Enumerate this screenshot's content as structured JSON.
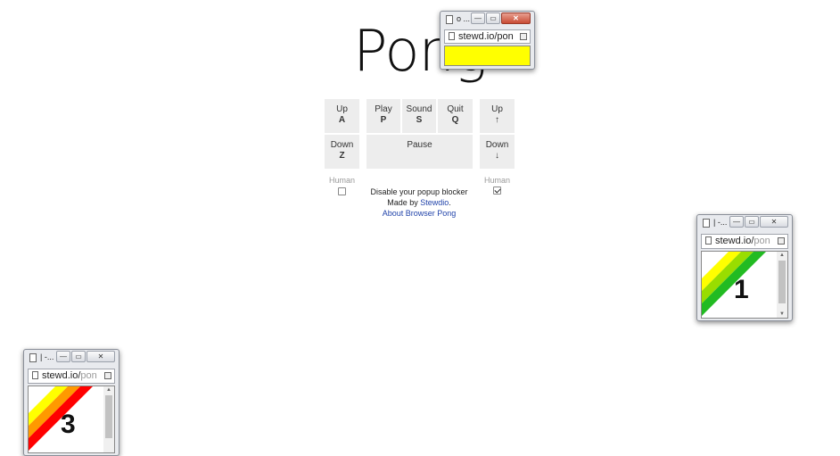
{
  "title": "Pong",
  "controls": {
    "left": {
      "up_label": "Up",
      "up_key": "A",
      "down_label": "Down",
      "down_key": "Z",
      "human_label": "Human",
      "human_checked": false
    },
    "middle": {
      "play_label": "Play",
      "play_key": "P",
      "sound_label": "Sound",
      "sound_key": "S",
      "quit_label": "Quit",
      "quit_key": "Q",
      "pause_label": "Pause"
    },
    "right": {
      "up_label": "Up",
      "up_key": "↑",
      "down_label": "Down",
      "down_key": "↓",
      "human_label": "Human",
      "human_checked": true
    }
  },
  "info": {
    "popup_notice": "Disable your popup blocker",
    "made_by_prefix": "Made by",
    "made_by_link": "Stewdio",
    "made_by_suffix": ".",
    "about_link": "About Browser Pong"
  },
  "popups": {
    "ball": {
      "title": "o ...",
      "url_main": "stewd.io/pon",
      "url_rest": "",
      "fill_color": "#ffff00"
    },
    "score_right": {
      "title": "| -...",
      "url_main": "stewd.io/",
      "url_rest": "pon",
      "score": "1",
      "stripe_colors": [
        "#ffff00",
        "#99dd00",
        "#22bb22"
      ]
    },
    "score_left": {
      "title": "| -...",
      "url_main": "stewd.io/",
      "url_rest": "pon",
      "score": "3",
      "stripe_colors": [
        "#ffff00",
        "#ff9900",
        "#ff0000"
      ]
    }
  },
  "window_controls": {
    "minimize": "—",
    "maximize": "▭",
    "close": "✕"
  }
}
